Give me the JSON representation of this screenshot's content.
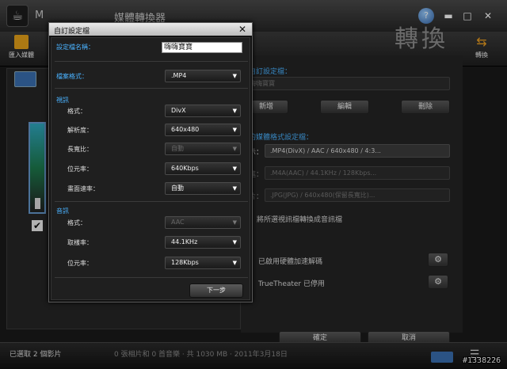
{
  "app": {
    "logo_glyph": "☕",
    "name": "M",
    "window_title": "媒體轉換器",
    "big_title": "轉換",
    "import_label": "匯入媒體",
    "convert_label": "轉換",
    "help_glyph": "?",
    "minimize_glyph": "▬",
    "maximize_glyph": "□",
    "close_glyph": "✕"
  },
  "right_panel": {
    "custom_profile_label": "自訂設定檔：",
    "profile_value": "嗨嗨寶寶",
    "buttons": [
      "新增",
      "編輯",
      "刪除"
    ],
    "format_settings_label": "的媒體格式設定檔：",
    "video_profile": ".MP4(DivX) / AAC / 640x480 / 4:3...",
    "audio_profile": ".M4A(AAC) / 44.1KHz / 128Kbps...",
    "image_profile": ".JPG(JPG) / 640x480(保留長寬比)...",
    "convert_all_text": "將所選視訊檔轉換成音訊檔",
    "hw_decode_text": "已啟用硬體加速解碼",
    "truetheater_text": "TrueTheater 已停用",
    "ok_label": "確定",
    "cancel_label": "取消",
    "gear_glyph": "⚙"
  },
  "status": {
    "text": "已選取 2 個影片",
    "extra": "0 張相片和 0 首音樂 · 共 1030 MB · 2011年3月18日"
  },
  "watermark": "#1338226",
  "dialog": {
    "title": "自訂設定檔",
    "close_glyph": "✕",
    "profile_name_label": "設定檔名稱：",
    "profile_name_value": "嗨嗨寶寶",
    "file_format_label": "檔案格式：",
    "file_format_value": ".MP4",
    "video_section": "視訊",
    "video": {
      "format_label": "格式：",
      "format_value": "DivX",
      "resolution_label": "解析度：",
      "resolution_value": "640x480",
      "aspect_label": "長寬比：",
      "aspect_value": "自動",
      "bitrate_label": "位元率：",
      "bitrate_value": "640Kbps",
      "framerate_label": "畫面速率：",
      "framerate_value": "自動"
    },
    "audio_section": "音訊",
    "audio": {
      "format_label": "格式：",
      "format_value": "AAC",
      "samplerate_label": "取樣率：",
      "samplerate_value": "44.1KHz",
      "bitrate_label": "位元率：",
      "bitrate_value": "128Kbps"
    },
    "next_label": "下一步",
    "arrow_glyph": "▼"
  }
}
